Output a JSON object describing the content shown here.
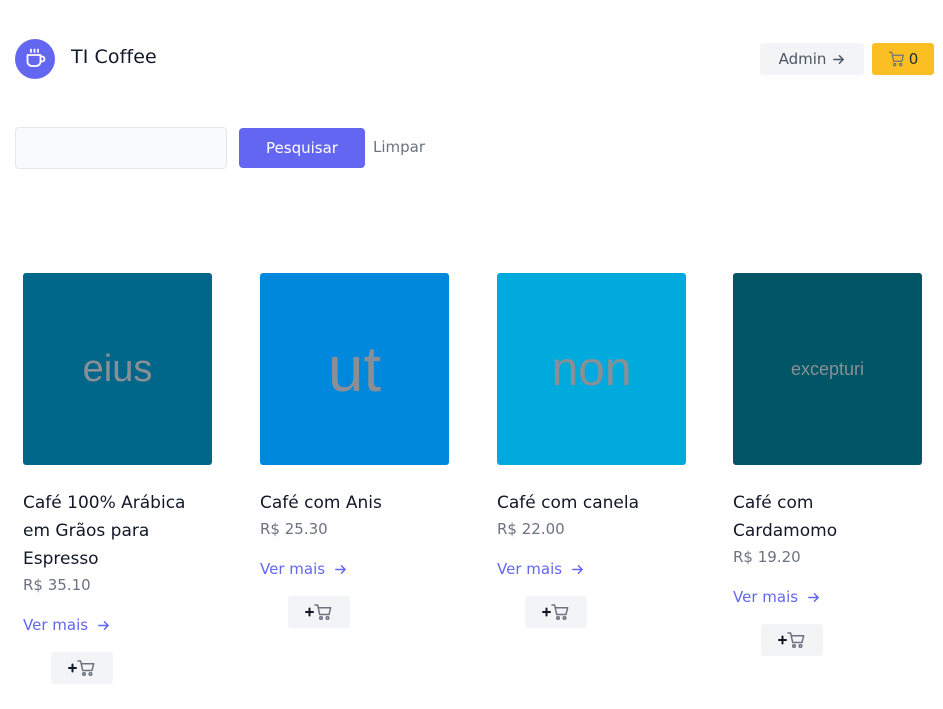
{
  "header": {
    "brand": "TI Coffee",
    "logo_icon": "coffee-cup-icon",
    "admin_label": "Admin",
    "cart_count": "0"
  },
  "search": {
    "value": "",
    "placeholder": "",
    "button_label": "Pesquisar",
    "clear_label": "Limpar"
  },
  "colors": {
    "accent": "#6366f1",
    "cart": "#fbbf24",
    "muted_bg": "#f3f4f6"
  },
  "products": [
    {
      "image_text": "eius",
      "image_bg": "#00678a",
      "title": "Café 100% Arábica em Grãos para Espresso",
      "price": "R$ 35.10",
      "more_label": "Ver mais"
    },
    {
      "image_text": "ut",
      "image_bg": "#0088dc",
      "title": "Café com Anis",
      "price": "R$ 25.30",
      "more_label": "Ver mais"
    },
    {
      "image_text": "non",
      "image_bg": "#00aadd",
      "title": "Café com canela",
      "price": "R$ 22.00",
      "more_label": "Ver mais"
    },
    {
      "image_text": "excepturi",
      "image_bg": "#005566",
      "title": "Café com Cardamomo",
      "price": "R$ 19.20",
      "more_label": "Ver mais"
    }
  ]
}
